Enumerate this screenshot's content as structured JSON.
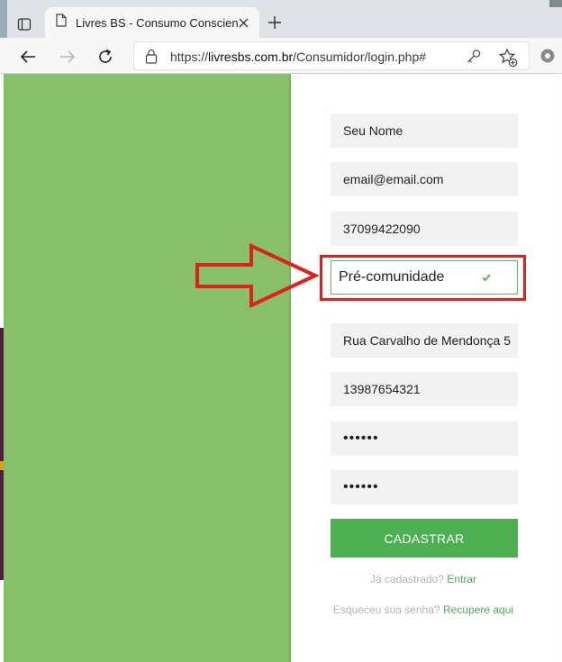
{
  "browser": {
    "tab": {
      "title": "Livres BS - Consumo Consciente"
    },
    "address": {
      "scheme": "https://",
      "domain": "livresbs.com.br",
      "path": "/Consumidor/login.php#"
    }
  },
  "form": {
    "name": "Seu Nome",
    "email": "email@email.com",
    "phone": "37099422090",
    "community": "Pré-comunidade",
    "address": "Rua Carvalho de Mendonça 5",
    "document": "13987654321",
    "password": "••••••",
    "password_confirm": "••••••",
    "submit_label": "Cadastrar"
  },
  "links": {
    "registered_prompt": "Já cadastrado?",
    "login_label": "Entrar",
    "forgot_prompt": "Esqueceu sua senha?",
    "recover_label": "Recupere aqui"
  },
  "colors": {
    "page_green": "#87c068",
    "button_green": "#4caf50",
    "annotation_red": "#e0201e"
  },
  "icons": [
    "tab-actions-icon",
    "page-icon",
    "close-icon",
    "plus-icon",
    "back-arrow-icon",
    "forward-arrow-icon",
    "refresh-icon",
    "lock-icon",
    "key-icon",
    "favorite-icon",
    "settings-icon",
    "check-icon"
  ]
}
